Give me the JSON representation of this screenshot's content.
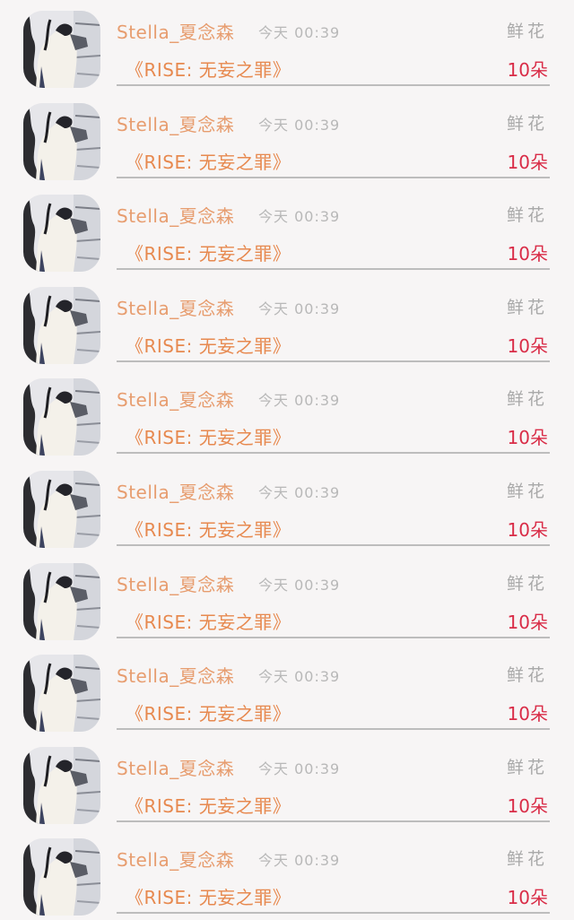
{
  "colors": {
    "name": "#e79d6f",
    "book": "#e7894f",
    "count": "#d92c47",
    "muted": "#b8b8b8",
    "divider": "#bdbdbd",
    "background": "#f7f5f5"
  },
  "items": [
    {
      "name": "Stella_夏念森",
      "time": "今天 00:39",
      "gift": "鲜花",
      "book": "《RISE: 无妄之罪》",
      "count": "10朵",
      "avatar_icon": "user-avatar"
    },
    {
      "name": "Stella_夏念森",
      "time": "今天 00:39",
      "gift": "鲜花",
      "book": "《RISE: 无妄之罪》",
      "count": "10朵",
      "avatar_icon": "user-avatar"
    },
    {
      "name": "Stella_夏念森",
      "time": "今天 00:39",
      "gift": "鲜花",
      "book": "《RISE: 无妄之罪》",
      "count": "10朵",
      "avatar_icon": "user-avatar"
    },
    {
      "name": "Stella_夏念森",
      "time": "今天 00:39",
      "gift": "鲜花",
      "book": "《RISE: 无妄之罪》",
      "count": "10朵",
      "avatar_icon": "user-avatar"
    },
    {
      "name": "Stella_夏念森",
      "time": "今天 00:39",
      "gift": "鲜花",
      "book": "《RISE: 无妄之罪》",
      "count": "10朵",
      "avatar_icon": "user-avatar"
    },
    {
      "name": "Stella_夏念森",
      "time": "今天 00:39",
      "gift": "鲜花",
      "book": "《RISE: 无妄之罪》",
      "count": "10朵",
      "avatar_icon": "user-avatar"
    },
    {
      "name": "Stella_夏念森",
      "time": "今天 00:39",
      "gift": "鲜花",
      "book": "《RISE: 无妄之罪》",
      "count": "10朵",
      "avatar_icon": "user-avatar"
    },
    {
      "name": "Stella_夏念森",
      "time": "今天 00:39",
      "gift": "鲜花",
      "book": "《RISE: 无妄之罪》",
      "count": "10朵",
      "avatar_icon": "user-avatar"
    },
    {
      "name": "Stella_夏念森",
      "time": "今天 00:39",
      "gift": "鲜花",
      "book": "《RISE: 无妄之罪》",
      "count": "10朵",
      "avatar_icon": "user-avatar"
    },
    {
      "name": "Stella_夏念森",
      "time": "今天 00:39",
      "gift": "鲜花",
      "book": "《RISE: 无妄之罪》",
      "count": "10朵",
      "avatar_icon": "user-avatar"
    }
  ]
}
